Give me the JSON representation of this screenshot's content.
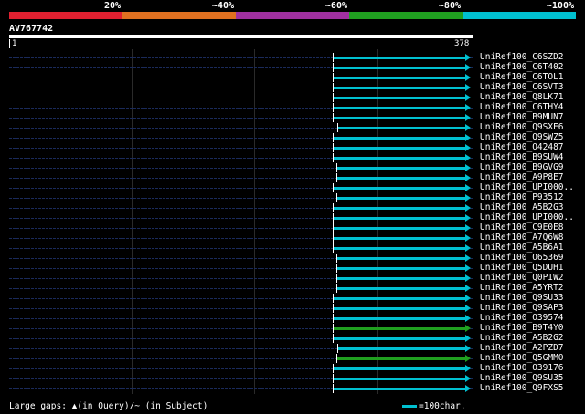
{
  "legend": {
    "segments": [
      {
        "label": "20%",
        "color": "#e02030"
      },
      {
        "label": "~40%",
        "color": "#e07020"
      },
      {
        "label": "~60%",
        "color": "#a030a0"
      },
      {
        "label": "~80%",
        "color": "#20a020"
      },
      {
        "label": "~100%",
        "color": "#00c0d0"
      }
    ]
  },
  "query": {
    "name": "AV767742",
    "start": "1",
    "end": "378"
  },
  "hits": [
    {
      "label": "UniRef100_C6SZD2",
      "color": "#00c0d0"
    },
    {
      "label": "UniRef100_C6T402",
      "color": "#00c0d0"
    },
    {
      "label": "UniRef100_C6TOL1",
      "color": "#00c0d0"
    },
    {
      "label": "UniRef100_C6SVT3",
      "color": "#00c0d0"
    },
    {
      "label": "UniRef100_Q8LK71",
      "color": "#00c0d0"
    },
    {
      "label": "UniRef100_C6THY4",
      "color": "#00c0d0"
    },
    {
      "label": "UniRef100_B9MUN7",
      "color": "#00c0d0"
    },
    {
      "label": "UniRef100_Q9SXE6",
      "color": "#00c0d0"
    },
    {
      "label": "UniRef100_Q9SWZ5",
      "color": "#00c0d0"
    },
    {
      "label": "UniRef100_O42487",
      "color": "#00c0d0"
    },
    {
      "label": "UniRef100_B9SUW4",
      "color": "#00c0d0"
    },
    {
      "label": "UniRef100_B9GVG9",
      "color": "#00c0d0"
    },
    {
      "label": "UniRef100_A9P8E7",
      "color": "#00c0d0"
    },
    {
      "label": "UniRef100_UPI000..",
      "color": "#00c0d0"
    },
    {
      "label": "UniRef100_P93512",
      "color": "#00c0d0"
    },
    {
      "label": "UniRef100_A5B2G3",
      "color": "#00c0d0"
    },
    {
      "label": "UniRef100_UPI000..",
      "color": "#00c0d0"
    },
    {
      "label": "UniRef100_C9E0E8",
      "color": "#00c0d0"
    },
    {
      "label": "UniRef100_A7Q6W8",
      "color": "#00c0d0"
    },
    {
      "label": "UniRef100_A5B6A1",
      "color": "#00c0d0"
    },
    {
      "label": "UniRef100_O65369",
      "color": "#00c0d0"
    },
    {
      "label": "UniRef100_Q5DUH1",
      "color": "#00c0d0"
    },
    {
      "label": "UniRef100_Q0PIW2",
      "color": "#00c0d0"
    },
    {
      "label": "UniRef100_A5YRT2",
      "color": "#00c0d0"
    },
    {
      "label": "UniRef100_Q9SU33",
      "color": "#00c0d0"
    },
    {
      "label": "UniRef100_Q9SAP3",
      "color": "#00c0d0"
    },
    {
      "label": "UniRef100_O39574",
      "color": "#00c0d0"
    },
    {
      "label": "UniRef100_B9T4Y0",
      "color": "#20a020"
    },
    {
      "label": "UniRef100_A5B2G2",
      "color": "#00c0d0"
    },
    {
      "label": "UniRef100_A2PZD7",
      "color": "#00c0d0"
    },
    {
      "label": "UniRef100_Q5GMM0",
      "color": "#20a020"
    },
    {
      "label": "UniRef100_O39176",
      "color": "#00c0d0"
    },
    {
      "label": "UniRef100_Q9SU35",
      "color": "#00c0d0"
    },
    {
      "label": "UniRef100_Q9FXS5",
      "color": "#00c0d0"
    }
  ],
  "footer": {
    "gaps_text": "Large gaps: ▲(in Query)/~ (in Subject)",
    "scale_text": "=100char."
  }
}
